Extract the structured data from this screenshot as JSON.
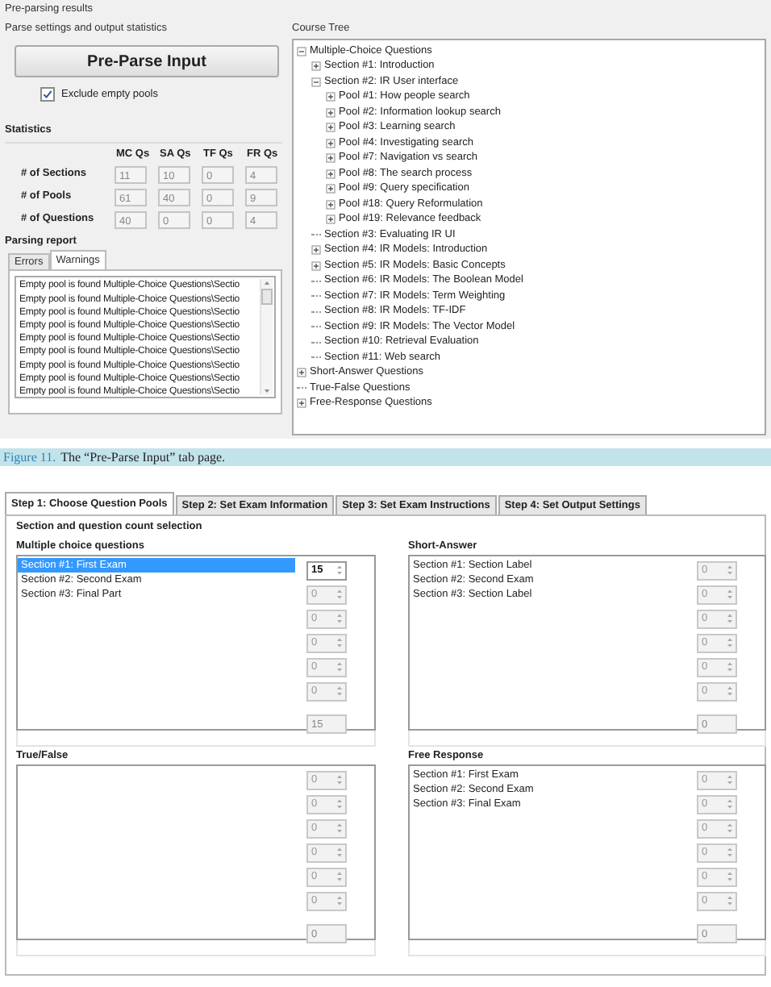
{
  "window": {
    "title": "Pre-parsing results"
  },
  "parse_panel": {
    "title": "Parse settings and output statistics",
    "button": "Pre-Parse Input",
    "exclude_empty": {
      "label": "Exclude empty pools",
      "checked": true
    }
  },
  "statistics": {
    "title": "Statistics",
    "columns": [
      "MC Qs",
      "SA Qs",
      "TF Qs",
      "FR Qs"
    ],
    "rows": [
      {
        "label": "# of Sections",
        "values": [
          "11",
          "10",
          "0",
          "4"
        ]
      },
      {
        "label": "# of Pools",
        "values": [
          "61",
          "40",
          "0",
          "9"
        ]
      },
      {
        "label": "# of Questions",
        "values": [
          "40",
          "0",
          "0",
          "4"
        ]
      }
    ]
  },
  "parsing_report": {
    "title": "Parsing report",
    "tabs": [
      {
        "label": "Errors",
        "selected": false
      },
      {
        "label": "Warnings",
        "selected": true
      }
    ],
    "lines": [
      "Empty pool is found Multiple-Choice Questions\\Sectio",
      "Empty pool is found Multiple-Choice Questions\\Sectio",
      "Empty pool is found Multiple-Choice Questions\\Sectio",
      "Empty pool is found Multiple-Choice Questions\\Sectio",
      "Empty pool is found Multiple-Choice Questions\\Sectio",
      "Empty pool is found Multiple-Choice Questions\\Sectio",
      "Empty pool is found Multiple-Choice Questions\\Sectio",
      "Empty pool is found Multiple-Choice Questions\\Sectio",
      "Empty pool is found Multiple-Choice Questions\\Sectio"
    ]
  },
  "course_tree": {
    "title": "Course Tree",
    "nodes": [
      {
        "label": "Multiple-Choice Questions",
        "kind": "expanded",
        "children": [
          {
            "label": "Section #1: Introduction",
            "kind": "collapsed"
          },
          {
            "label": "Section #2: IR User interface",
            "kind": "expanded",
            "children": [
              {
                "label": "Pool #1: How people search",
                "kind": "collapsed"
              },
              {
                "label": "Pool #2: Information lookup search",
                "kind": "collapsed"
              },
              {
                "label": "Pool #3: Learning search",
                "kind": "collapsed"
              },
              {
                "label": "Pool #4: Investigating search",
                "kind": "collapsed"
              },
              {
                "label": "Pool #7: Navigation vs search",
                "kind": "collapsed"
              },
              {
                "label": "Pool #8: The search process",
                "kind": "collapsed"
              },
              {
                "label": "Pool #9: Query specification",
                "kind": "collapsed"
              },
              {
                "label": "Pool #18: Query Reformulation",
                "kind": "collapsed"
              },
              {
                "label": "Pool #19: Relevance feedback",
                "kind": "collapsed"
              }
            ]
          },
          {
            "label": "Section #3: Evaluating IR UI",
            "kind": "leaf"
          },
          {
            "label": "Section #4: IR Models: Introduction",
            "kind": "collapsed"
          },
          {
            "label": "Section #5: IR Models: Basic Concepts",
            "kind": "collapsed"
          },
          {
            "label": "Section #6: IR Models: The Boolean Model",
            "kind": "leaf"
          },
          {
            "label": "Section #7: IR Models: Term Weighting",
            "kind": "leaf"
          },
          {
            "label": "Section #8: IR Models: TF-IDF",
            "kind": "leaf"
          },
          {
            "label": "Section #9: IR Models: The Vector Model",
            "kind": "leaf"
          },
          {
            "label": "Section #10: Retrieval Evaluation",
            "kind": "leaf"
          },
          {
            "label": "Section #11: Web search",
            "kind": "leaf"
          }
        ]
      },
      {
        "label": "Short-Answer Questions",
        "kind": "collapsed"
      },
      {
        "label": "True-False Questions",
        "kind": "leaf"
      },
      {
        "label": "Free-Response Questions",
        "kind": "collapsed"
      }
    ]
  },
  "caption": {
    "label": "Figure 11.",
    "text": "The “Pre-Parse Input” tab page."
  },
  "wizard": {
    "tabs": [
      {
        "label": "Step 1: Choose Question Pools",
        "selected": true
      },
      {
        "label": "Step 2: Set Exam Information",
        "selected": false
      },
      {
        "label": "Step 3: Set Exam Instructions",
        "selected": false
      },
      {
        "label": "Step 4: Set Output Settings",
        "selected": false
      }
    ],
    "title": "Section and question count selection",
    "groups": [
      {
        "title": "Multiple choice questions",
        "items": [
          {
            "label": "Section #1: First Exam",
            "selected": true
          },
          {
            "label": "Section #2: Second Exam",
            "selected": false
          },
          {
            "label": "Section #3: Final Part",
            "selected": false
          }
        ],
        "counts": [
          {
            "value": "15",
            "disabled": false
          },
          {
            "value": "0",
            "disabled": true
          },
          {
            "value": "0",
            "disabled": true
          },
          {
            "value": "0",
            "disabled": true
          },
          {
            "value": "0",
            "disabled": true
          },
          {
            "value": "0",
            "disabled": true
          }
        ],
        "total": "15"
      },
      {
        "title": "Short-Answer",
        "items": [
          {
            "label": "Section #1: Section Label",
            "selected": false
          },
          {
            "label": "Section #2: Second Exam",
            "selected": false
          },
          {
            "label": "Section #3: Section Label",
            "selected": false
          }
        ],
        "counts": [
          {
            "value": "0",
            "disabled": true
          },
          {
            "value": "0",
            "disabled": true
          },
          {
            "value": "0",
            "disabled": true
          },
          {
            "value": "0",
            "disabled": true
          },
          {
            "value": "0",
            "disabled": true
          },
          {
            "value": "0",
            "disabled": true
          }
        ],
        "total": "0"
      },
      {
        "title": "True/False",
        "counts": [
          {
            "value": "0",
            "disabled": true
          },
          {
            "value": "0",
            "disabled": true
          },
          {
            "value": "0",
            "disabled": true
          },
          {
            "value": "0",
            "disabled": true
          },
          {
            "value": "0",
            "disabled": true
          },
          {
            "value": "0",
            "disabled": true
          }
        ],
        "total": "0"
      },
      {
        "title": "Free Response",
        "items": [
          {
            "label": "Section #1: First Exam",
            "selected": false
          },
          {
            "label": "Section #2: Second Exam",
            "selected": false
          },
          {
            "label": "Section #3: Final Exam",
            "selected": false
          }
        ],
        "counts": [
          {
            "value": "0",
            "disabled": true
          },
          {
            "value": "0",
            "disabled": true
          },
          {
            "value": "0",
            "disabled": true
          },
          {
            "value": "0",
            "disabled": true
          },
          {
            "value": "0",
            "disabled": true
          },
          {
            "value": "0",
            "disabled": true
          }
        ],
        "total": "0"
      }
    ]
  }
}
